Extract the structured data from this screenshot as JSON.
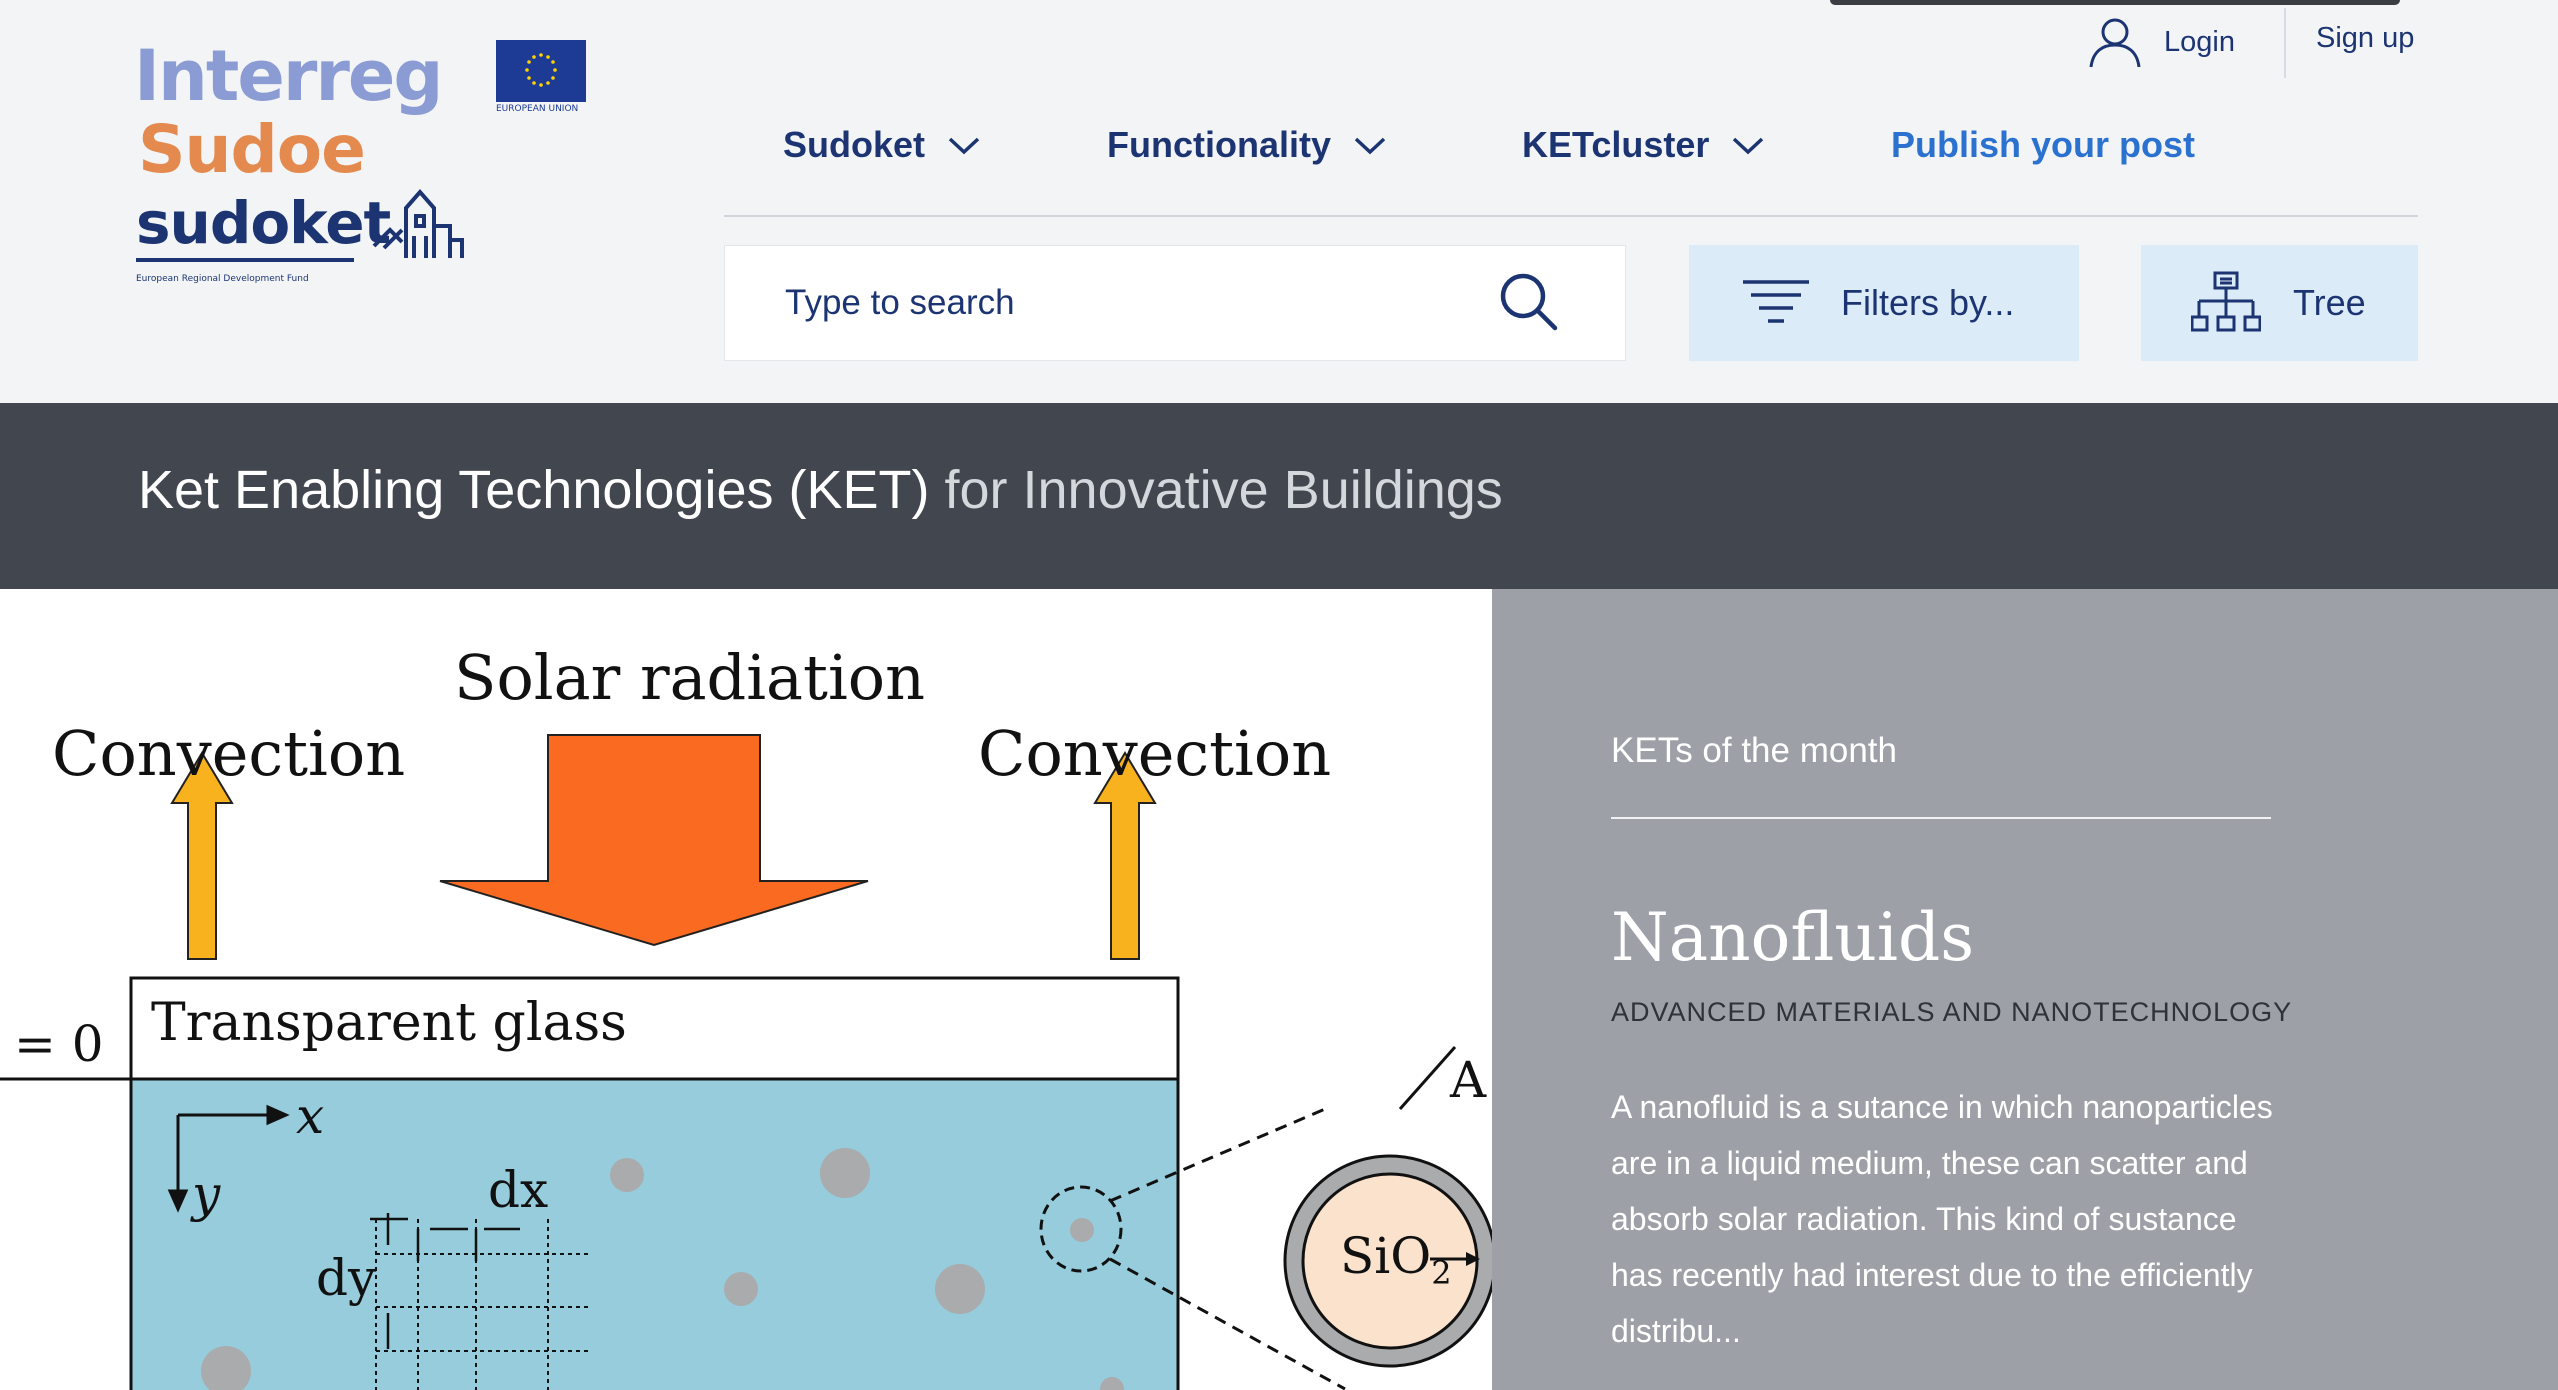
{
  "brand": {
    "logo_line1": "Interreg",
    "logo_line2": "Sudoe",
    "logo_line3": "sudoket",
    "logo_fund": "European Regional Development Fund",
    "eu_label": "EUROPEAN UNION",
    "colors": {
      "interreg": "#8b9bd4",
      "sudoe": "#e48a4f",
      "sudoket": "#1c3572",
      "eu_flag": "#1d3b95"
    }
  },
  "account": {
    "login_label": "Login",
    "signup_label": "Sign up"
  },
  "nav": {
    "items": [
      {
        "label": "Sudoket",
        "icon": "chevron-down-icon"
      },
      {
        "label": "Functionality",
        "icon": "chevron-down-icon"
      },
      {
        "label": "KETcluster",
        "icon": "chevron-down-icon"
      },
      {
        "label": "Publish your post"
      }
    ]
  },
  "search": {
    "placeholder": "Type to search",
    "icon": "search-icon"
  },
  "toolbar": {
    "filters_label": "Filters by...",
    "filters_icon": "filter-icon",
    "tree_label": "Tree",
    "tree_icon": "sitemap-icon"
  },
  "banner": {
    "title_strong": "Ket Enabling Technologies (KET)",
    "title_light": "for Innovative Buildings"
  },
  "figure": {
    "label_solar": "Solar radiation",
    "label_convection_left": "Convection",
    "label_convection_right": "Convection",
    "label_glass": "Transparent glass",
    "label_origin": "= 0",
    "label_x": "x",
    "label_y": "y",
    "label_dx": "dx",
    "label_dy": "dy",
    "label_sio2": "SiO",
    "label_sio2_sub": "2",
    "label_a": "A",
    "colors": {
      "solar_arrow": "#fb6a21",
      "convection_arrow": "#f7b21e",
      "fluid": "#96ccdb",
      "particle": "#a9abad",
      "core": "#fae2cd"
    }
  },
  "feature": {
    "kicker": "KETs of the month",
    "title": "Nanofluids",
    "category": "ADVANCED MATERIALS AND NANOTECHNOLOGY",
    "excerpt": "A nanofluid is a sutance in which nanoparticles are in a liquid medium, these can scatter and absorb solar radiation. This kind of sustance has recently had interest due to the efficiently distribu..."
  },
  "theme": {
    "page_bg": "#f3f4f6",
    "primary": "#1c3572",
    "link": "#2a71d0",
    "button_bg": "#dcebf8",
    "band_bg": "#42474f",
    "panel_bg": "#9da1a7"
  }
}
